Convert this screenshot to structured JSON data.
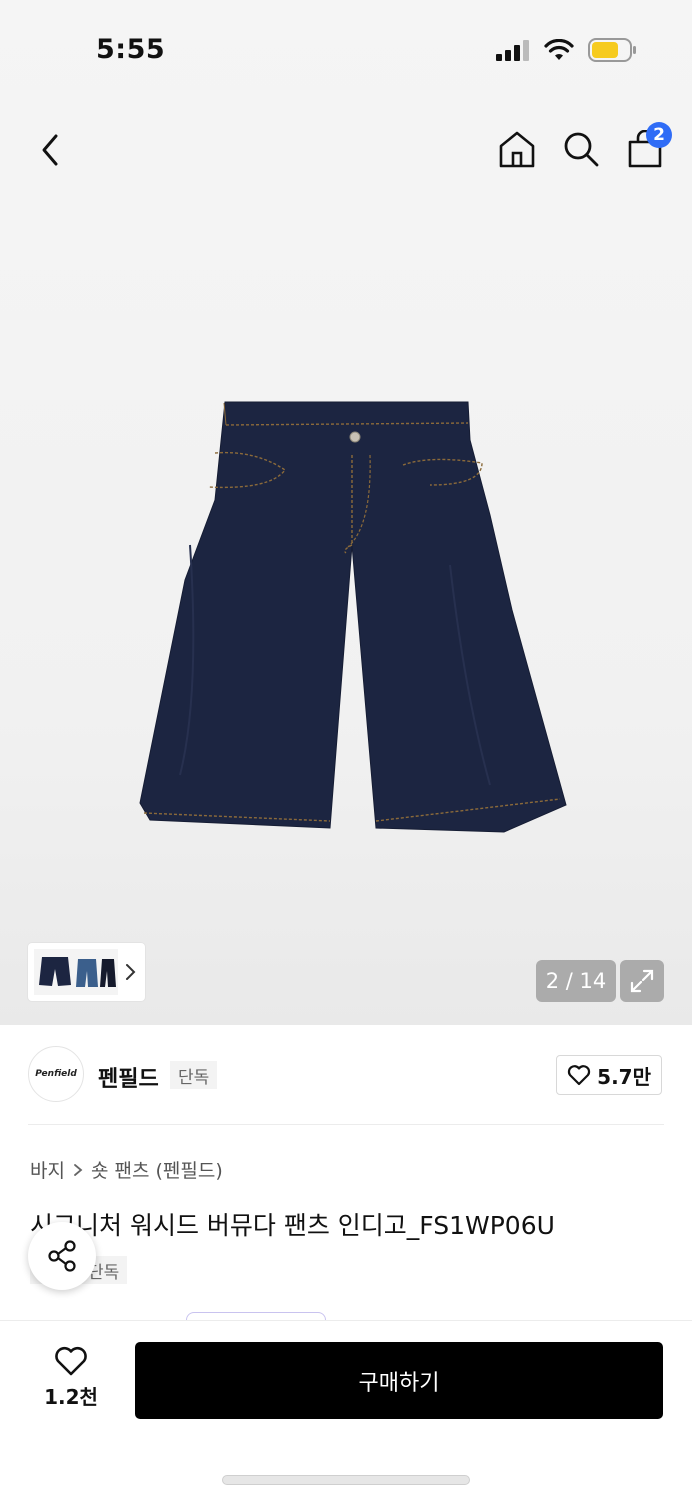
{
  "status_bar": {
    "time": "5:55"
  },
  "header": {
    "cart_count": "2"
  },
  "gallery": {
    "counter": "2 / 14"
  },
  "brand": {
    "logo_text": "Penfield",
    "name": "펜필드",
    "tag": "단독",
    "likes": "5.7만"
  },
  "product": {
    "breadcrumb": [
      "바지",
      "숏 팬츠 (펜필드)"
    ],
    "title": "시그니처 워시드 버뮤다 팬츠 인디고_FS1WP06U",
    "tag": "단독"
  },
  "bottom_bar": {
    "wish_count": "1.2천",
    "buy_label": "구매하기"
  },
  "colors": {
    "accent_blue": "#2f6cf6",
    "buy_button": "#000000",
    "denim": "#1c2541"
  }
}
